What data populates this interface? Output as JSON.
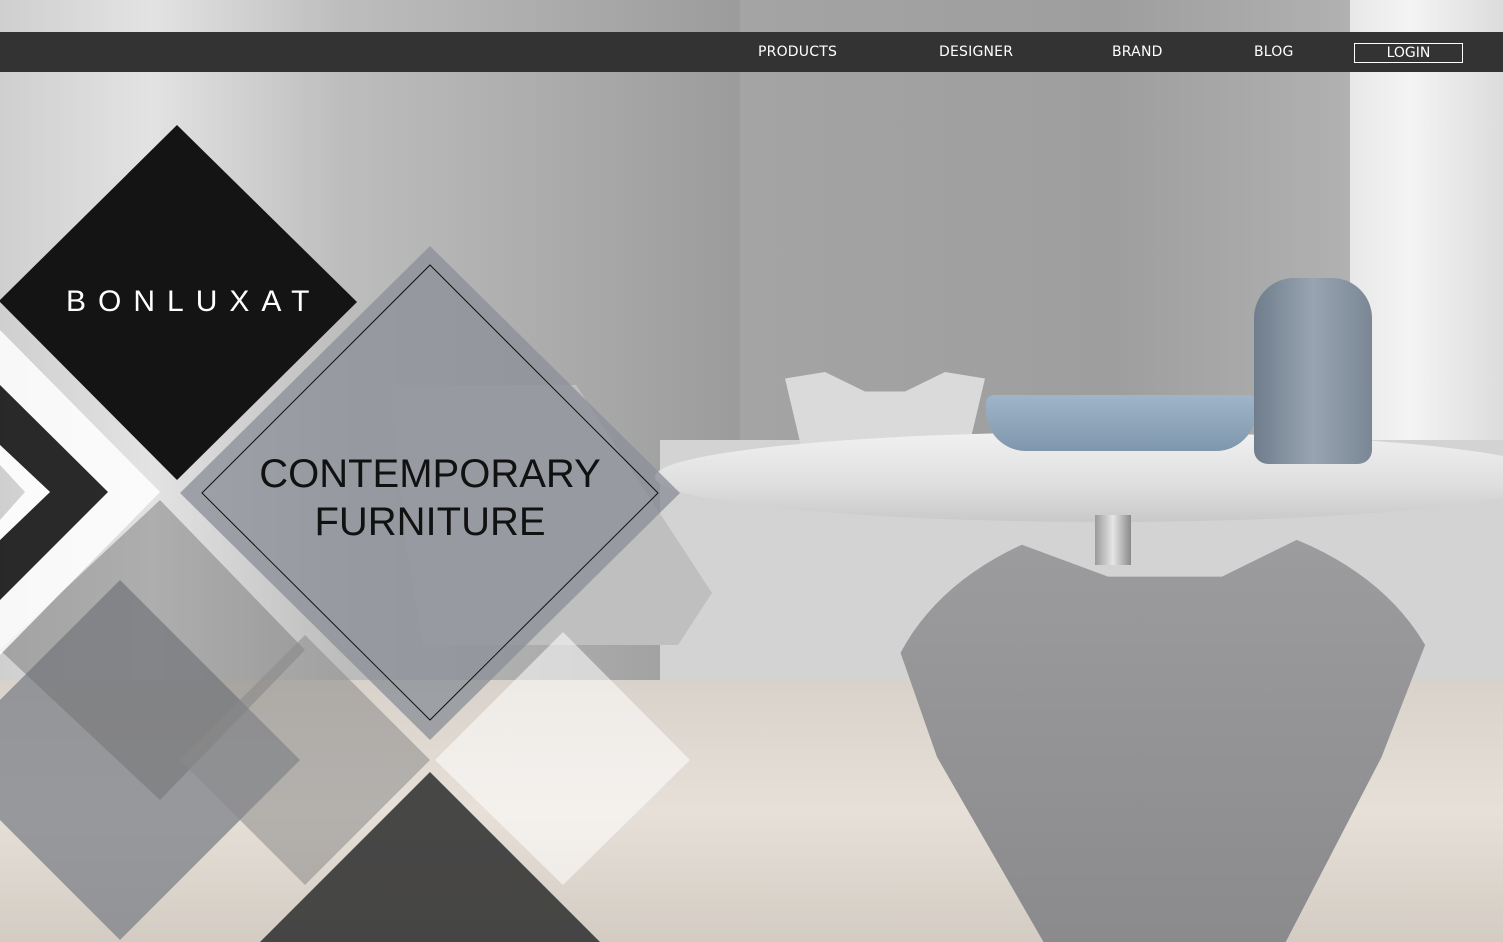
{
  "nav": {
    "items": [
      {
        "label": "PRODUCTS"
      },
      {
        "label": "DESIGNER"
      },
      {
        "label": "BRAND"
      },
      {
        "label": "BLOG"
      }
    ],
    "login_label": "LOGIN"
  },
  "hero": {
    "brand": "BONLUXAT",
    "headline_line1": "CONTEMPORARY",
    "headline_line2": "FURNITURE",
    "background": "dining-room-photo"
  },
  "colors": {
    "nav_bg": "#333333",
    "dark_diamond": "#141414",
    "gray_diamond": "#8c9199",
    "accent_text": "#111111"
  }
}
